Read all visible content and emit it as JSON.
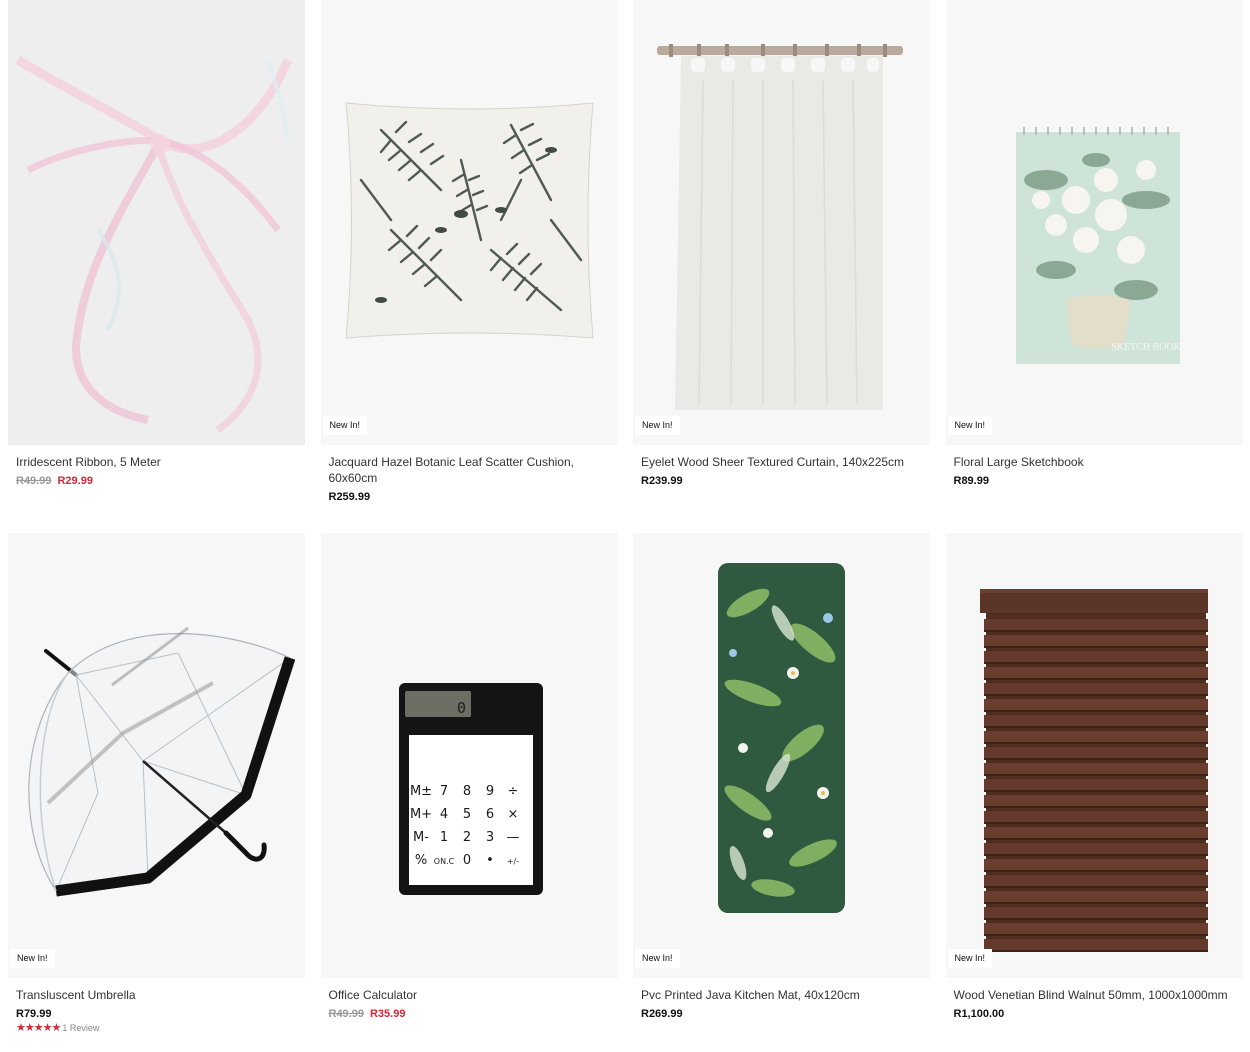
{
  "products": [
    {
      "name": "Irridescent Ribbon, 5 Meter",
      "old_price": "R49.99",
      "price": "R29.99",
      "badge": "",
      "image": "ribbon-image"
    },
    {
      "name": "Jacquard Hazel Botanic Leaf Scatter Cushion, 60x60cm",
      "old_price": "",
      "price": "R259.99",
      "badge": "New In!",
      "image": "cushion-image"
    },
    {
      "name": "Eyelet Wood Sheer Textured Curtain, 140x225cm",
      "old_price": "",
      "price": "R239.99",
      "badge": "New In!",
      "image": "curtain-image"
    },
    {
      "name": "Floral Large Sketchbook",
      "old_price": "",
      "price": "R89.99",
      "badge": "New In!",
      "image": "sketchbook-image",
      "cover_text": "SKETCH BOOK"
    },
    {
      "name": "Transluscent Umbrella",
      "old_price": "",
      "price": "R79.99",
      "badge": "New In!",
      "image": "umbrella-image",
      "rating": 5,
      "stars": "★★★★★",
      "reviews": "1 Review"
    },
    {
      "name": "Office Calculator",
      "old_price": "R49.99",
      "price": "R35.99",
      "badge": "",
      "image": "calculator-image",
      "keys": [
        "M±",
        "7",
        "8",
        "9",
        "÷",
        "M+",
        "4",
        "5",
        "6",
        "×",
        "M-",
        "1",
        "2",
        "3",
        "—",
        "%",
        "ON.C",
        "0",
        "•",
        "+/-"
      ],
      "display": "0"
    },
    {
      "name": "Pvc Printed Java Kitchen Mat, 40x120cm",
      "old_price": "",
      "price": "R269.99",
      "badge": "New In!",
      "image": "kitchen-mat-image"
    },
    {
      "name": "Wood Venetian Blind Walnut 50mm, 1000x1000mm",
      "old_price": "",
      "price": "R1,100.00",
      "badge": "New In!",
      "image": "venetian-blind-image"
    }
  ],
  "colors": {
    "sale": "#d1283a",
    "image_bg": "#f7f7f7",
    "walnut": "#5b3528"
  }
}
